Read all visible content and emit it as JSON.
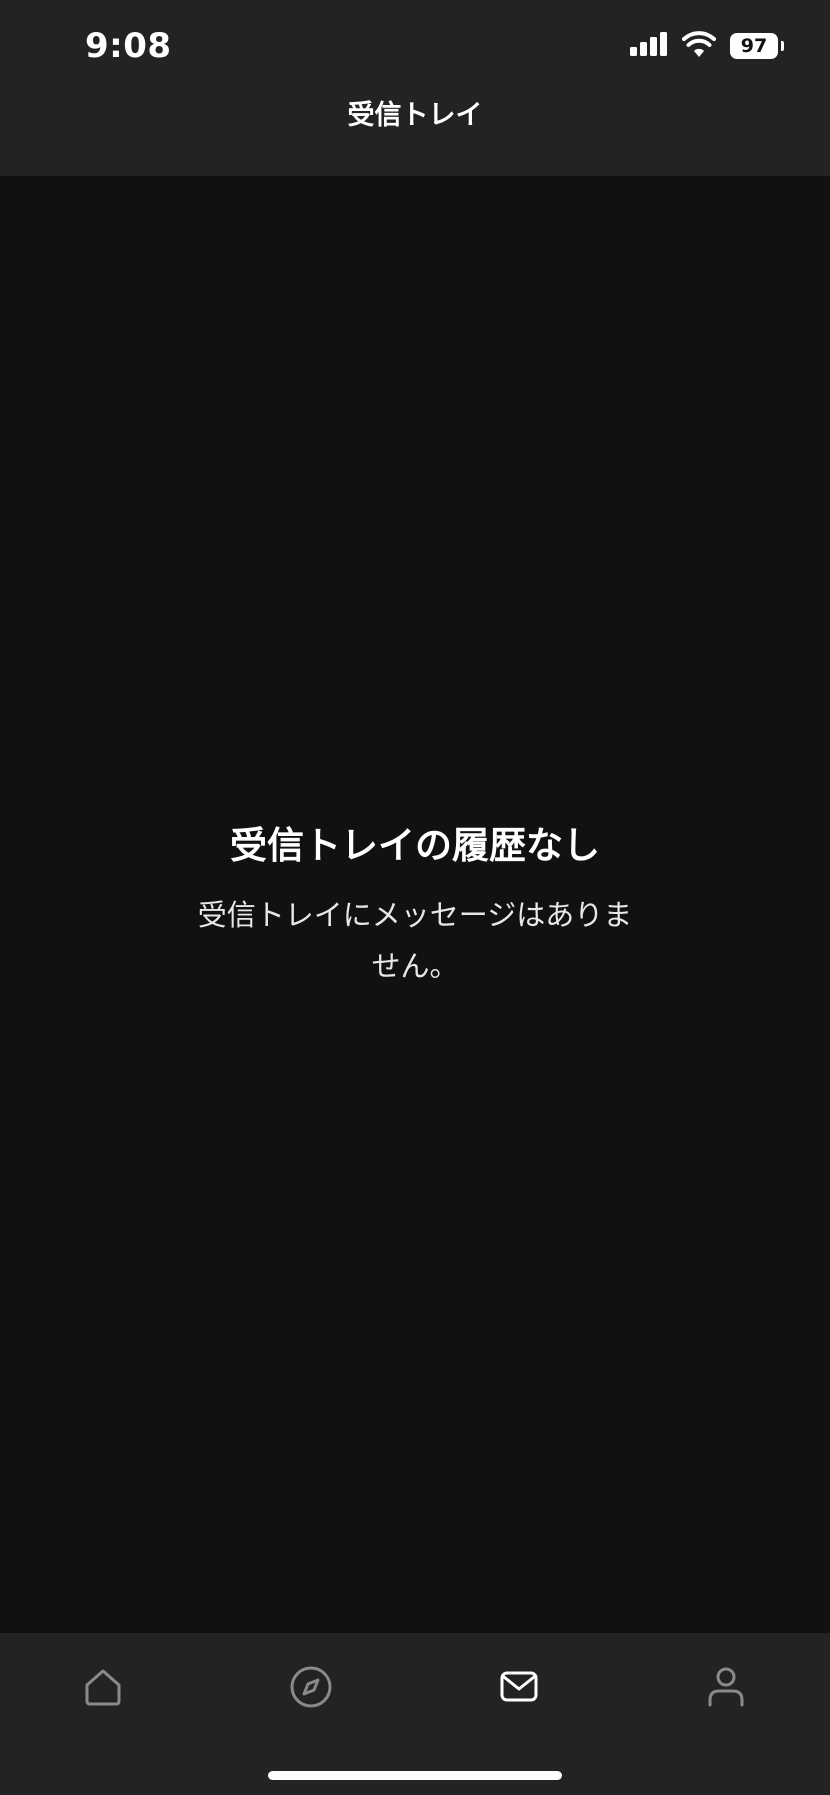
{
  "status_bar": {
    "time": "9:08",
    "battery": "97"
  },
  "header": {
    "title": "受信トレイ"
  },
  "empty_state": {
    "title": "受信トレイの履歴なし",
    "message": "受信トレイにメッセージはありません。"
  },
  "tab_bar": {
    "items": [
      {
        "icon": "home-icon",
        "active": false
      },
      {
        "icon": "compass-icon",
        "active": false
      },
      {
        "icon": "mail-icon",
        "active": true
      },
      {
        "icon": "profile-icon",
        "active": false
      }
    ]
  },
  "colors": {
    "background": "#111111",
    "bar_background": "#232323",
    "active_icon": "#ffffff",
    "inactive_icon": "#8a8a8a"
  }
}
